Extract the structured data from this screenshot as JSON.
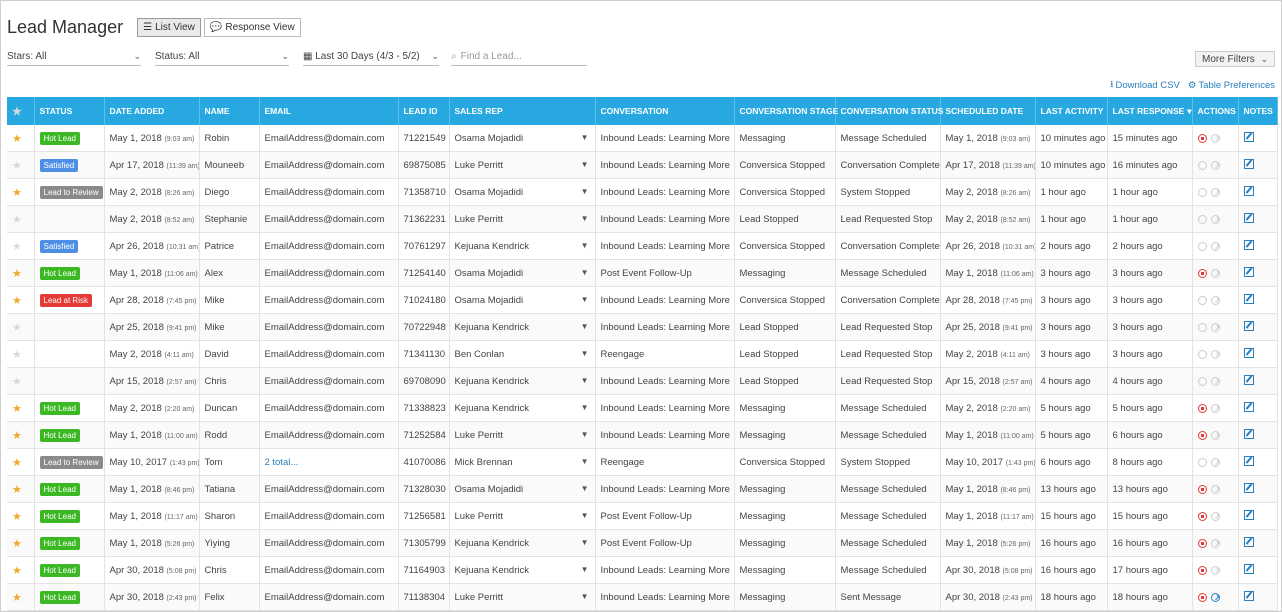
{
  "header": {
    "title": "Lead Manager",
    "list_view": "List View",
    "response_view": "Response View"
  },
  "filters": {
    "stars": "Stars: All",
    "status": "Status: All",
    "date_range": "Last 30 Days (4/3 - 5/2)",
    "search_placeholder": "Find a Lead...",
    "more_filters": "More Filters"
  },
  "links": {
    "download_csv": "Download CSV",
    "table_preferences": "Table Preferences"
  },
  "columns": [
    "STATUS",
    "DATE ADDED",
    "NAME",
    "EMAIL",
    "LEAD ID",
    "SALES REP",
    "CONVERSATION",
    "CONVERSATION STAGE",
    "CONVERSATION STATUS",
    "SCHEDULED DATE",
    "LAST ACTIVITY",
    "LAST RESPONSE",
    "ACTIONS",
    "NOTES"
  ],
  "sort_indicator": "▾",
  "colors": {
    "hot": "#3cb824",
    "satisfied": "#4e8fe6",
    "review": "#8a8a8a",
    "risk": "#e53935",
    "header": "#27a8e0"
  },
  "rows": [
    {
      "star": true,
      "status": "Hot Lead",
      "status_type": "hot",
      "date": "May 1, 2018",
      "date_time": "(9:03 am)",
      "name": "Robin",
      "email": "EmailAddress@domain.com",
      "lead_id": "71221549",
      "rep": "Osama Mojadidi",
      "conversation": "Inbound Leads: Learning More",
      "stage": "Messaging",
      "conv_status": "Message Scheduled",
      "sched": "May 1, 2018",
      "sched_time": "(9:03 am)",
      "last_activity": "10 minutes ago",
      "last_response": "15 minutes ago",
      "stop_active": true,
      "go_active": false
    },
    {
      "star": false,
      "status": "Satisfied",
      "status_type": "sat",
      "date": "Apr 17, 2018",
      "date_time": "(11:39 am)",
      "name": "Mouneeb",
      "email": "EmailAddress@domain.com",
      "lead_id": "69875085",
      "rep": "Luke Perritt",
      "conversation": "Inbound Leads: Learning More",
      "stage": "Conversica Stopped",
      "conv_status": "Conversation Complete",
      "sched": "Apr 17, 2018",
      "sched_time": "(11:39 am)",
      "last_activity": "10 minutes ago",
      "last_response": "16 minutes ago",
      "stop_active": false,
      "go_active": false
    },
    {
      "star": true,
      "status": "Lead to Review",
      "status_type": "rev",
      "date": "May 2, 2018",
      "date_time": "(8:26 am)",
      "name": "Diego",
      "email": "EmailAddress@domain.com",
      "lead_id": "71358710",
      "rep": "Osama Mojadidi",
      "conversation": "Inbound Leads: Learning More",
      "stage": "Conversica Stopped",
      "conv_status": "System Stopped",
      "sched": "May 2, 2018",
      "sched_time": "(8:26 am)",
      "last_activity": "1 hour ago",
      "last_response": "1 hour ago",
      "stop_active": false,
      "go_active": false
    },
    {
      "star": false,
      "status": "",
      "status_type": "",
      "date": "May 2, 2018",
      "date_time": "(8:52 am)",
      "name": "Stephanie",
      "email": "EmailAddress@domain.com",
      "lead_id": "71362231",
      "rep": "Luke Perritt",
      "conversation": "Inbound Leads: Learning More",
      "stage": "Lead Stopped",
      "conv_status": "Lead Requested Stop",
      "sched": "May 2, 2018",
      "sched_time": "(8:52 am)",
      "last_activity": "1 hour ago",
      "last_response": "1 hour ago",
      "stop_active": false,
      "go_active": false
    },
    {
      "star": false,
      "status": "Satisfied",
      "status_type": "sat",
      "date": "Apr 26, 2018",
      "date_time": "(10:31 am)",
      "name": "Patrice",
      "email": "EmailAddress@domain.com",
      "lead_id": "70761297",
      "rep": "Kejuana Kendrick",
      "conversation": "Inbound Leads: Learning More",
      "stage": "Conversica Stopped",
      "conv_status": "Conversation Complete",
      "sched": "Apr 26, 2018",
      "sched_time": "(10:31 am)",
      "last_activity": "2 hours ago",
      "last_response": "2 hours ago",
      "stop_active": false,
      "go_active": false
    },
    {
      "star": true,
      "status": "Hot Lead",
      "status_type": "hot",
      "date": "May 1, 2018",
      "date_time": "(11:06 am)",
      "name": "Alex",
      "email": "EmailAddress@domain.com",
      "lead_id": "71254140",
      "rep": "Osama Mojadidi",
      "conversation": "Post Event Follow-Up",
      "stage": "Messaging",
      "conv_status": "Message Scheduled",
      "sched": "May 1, 2018",
      "sched_time": "(11:06 am)",
      "last_activity": "3 hours ago",
      "last_response": "3 hours ago",
      "stop_active": true,
      "go_active": false
    },
    {
      "star": true,
      "status": "Lead at Risk",
      "status_type": "risk",
      "date": "Apr 28, 2018",
      "date_time": "(7:45 pm)",
      "name": "Mike",
      "email": "EmailAddress@domain.com",
      "lead_id": "71024180",
      "rep": "Osama Mojadidi",
      "conversation": "Inbound Leads: Learning More",
      "stage": "Conversica Stopped",
      "conv_status": "Conversation Complete",
      "sched": "Apr 28, 2018",
      "sched_time": "(7:45 pm)",
      "last_activity": "3 hours ago",
      "last_response": "3 hours ago",
      "stop_active": false,
      "go_active": false
    },
    {
      "star": false,
      "status": "",
      "status_type": "",
      "date": "Apr 25, 2018",
      "date_time": "(9:41 pm)",
      "name": "Mike",
      "email": "EmailAddress@domain.com",
      "lead_id": "70722948",
      "rep": "Kejuana Kendrick",
      "conversation": "Inbound Leads: Learning More",
      "stage": "Lead Stopped",
      "conv_status": "Lead Requested Stop",
      "sched": "Apr 25, 2018",
      "sched_time": "(9:41 pm)",
      "last_activity": "3 hours ago",
      "last_response": "3 hours ago",
      "stop_active": false,
      "go_active": false
    },
    {
      "star": false,
      "status": "",
      "status_type": "",
      "date": "May 2, 2018",
      "date_time": "(4:11 am)",
      "name": "David",
      "email": "EmailAddress@domain.com",
      "lead_id": "71341130",
      "rep": "Ben Conlan",
      "conversation": "Reengage",
      "stage": "Lead Stopped",
      "conv_status": "Lead Requested Stop",
      "sched": "May 2, 2018",
      "sched_time": "(4:11 am)",
      "last_activity": "3 hours ago",
      "last_response": "3 hours ago",
      "stop_active": false,
      "go_active": false
    },
    {
      "star": false,
      "status": "",
      "status_type": "",
      "date": "Apr 15, 2018",
      "date_time": "(2:57 am)",
      "name": "Chris",
      "email": "EmailAddress@domain.com",
      "lead_id": "69708090",
      "rep": "Kejuana Kendrick",
      "conversation": "Inbound Leads: Learning More",
      "stage": "Lead Stopped",
      "conv_status": "Lead Requested Stop",
      "sched": "Apr 15, 2018",
      "sched_time": "(2:57 am)",
      "last_activity": "4 hours ago",
      "last_response": "4 hours ago",
      "stop_active": false,
      "go_active": false
    },
    {
      "star": true,
      "status": "Hot Lead",
      "status_type": "hot",
      "date": "May 2, 2018",
      "date_time": "(2:20 am)",
      "name": "Duncan",
      "email": "EmailAddress@domain.com",
      "lead_id": "71338823",
      "rep": "Kejuana Kendrick",
      "conversation": "Inbound Leads: Learning More",
      "stage": "Messaging",
      "conv_status": "Message Scheduled",
      "sched": "May 2, 2018",
      "sched_time": "(2:20 am)",
      "last_activity": "5 hours ago",
      "last_response": "5 hours ago",
      "stop_active": true,
      "go_active": false
    },
    {
      "star": true,
      "status": "Hot Lead",
      "status_type": "hot",
      "date": "May 1, 2018",
      "date_time": "(11:00 am)",
      "name": "Rodd",
      "email": "EmailAddress@domain.com",
      "lead_id": "71252584",
      "rep": "Luke Perritt",
      "conversation": "Inbound Leads: Learning More",
      "stage": "Messaging",
      "conv_status": "Message Scheduled",
      "sched": "May 1, 2018",
      "sched_time": "(11:00 am)",
      "last_activity": "5 hours ago",
      "last_response": "6 hours ago",
      "stop_active": true,
      "go_active": false
    },
    {
      "star": true,
      "status": "Lead to Review",
      "status_type": "rev",
      "date": "May 10, 2017",
      "date_time": "(1:43 pm)",
      "name": "Tom",
      "email": "2 total...",
      "email_link": true,
      "lead_id": "41070086",
      "rep": "Mick Brennan",
      "conversation": "Reengage",
      "stage": "Conversica Stopped",
      "conv_status": "System Stopped",
      "sched": "May 10, 2017",
      "sched_time": "(1:43 pm)",
      "last_activity": "6 hours ago",
      "last_response": "8 hours ago",
      "stop_active": false,
      "go_active": false
    },
    {
      "star": true,
      "status": "Hot Lead",
      "status_type": "hot",
      "date": "May 1, 2018",
      "date_time": "(8:46 pm)",
      "name": "Tatiana",
      "email": "EmailAddress@domain.com",
      "lead_id": "71328030",
      "rep": "Osama Mojadidi",
      "conversation": "Inbound Leads: Learning More",
      "stage": "Messaging",
      "conv_status": "Message Scheduled",
      "sched": "May 1, 2018",
      "sched_time": "(8:46 pm)",
      "last_activity": "13 hours ago",
      "last_response": "13 hours ago",
      "stop_active": true,
      "go_active": false
    },
    {
      "star": true,
      "status": "Hot Lead",
      "status_type": "hot",
      "date": "May 1, 2018",
      "date_time": "(11:17 am)",
      "name": "Sharon",
      "email": "EmailAddress@domain.com",
      "lead_id": "71256581",
      "rep": "Luke Perritt",
      "conversation": "Post Event Follow-Up",
      "stage": "Messaging",
      "conv_status": "Message Scheduled",
      "sched": "May 1, 2018",
      "sched_time": "(11:17 am)",
      "last_activity": "15 hours ago",
      "last_response": "15 hours ago",
      "stop_active": true,
      "go_active": false
    },
    {
      "star": true,
      "status": "Hot Lead",
      "status_type": "hot",
      "date": "May 1, 2018",
      "date_time": "(5:26 pm)",
      "name": "Yiying",
      "email": "EmailAddress@domain.com",
      "lead_id": "71305799",
      "rep": "Kejuana Kendrick",
      "conversation": "Post Event Follow-Up",
      "stage": "Messaging",
      "conv_status": "Message Scheduled",
      "sched": "May 1, 2018",
      "sched_time": "(5:26 pm)",
      "last_activity": "16 hours ago",
      "last_response": "16 hours ago",
      "stop_active": true,
      "go_active": false
    },
    {
      "star": true,
      "status": "Hot Lead",
      "status_type": "hot",
      "date": "Apr 30, 2018",
      "date_time": "(5:08 pm)",
      "name": "Chris",
      "email": "EmailAddress@domain.com",
      "lead_id": "71164903",
      "rep": "Kejuana Kendrick",
      "conversation": "Inbound Leads: Learning More",
      "stage": "Messaging",
      "conv_status": "Message Scheduled",
      "sched": "Apr 30, 2018",
      "sched_time": "(5:08 pm)",
      "last_activity": "16 hours ago",
      "last_response": "17 hours ago",
      "stop_active": true,
      "go_active": false
    },
    {
      "star": true,
      "status": "Hot Lead",
      "status_type": "hot",
      "date": "Apr 30, 2018",
      "date_time": "(2:43 pm)",
      "name": "Felix",
      "email": "EmailAddress@domain.com",
      "lead_id": "71138304",
      "rep": "Luke Perritt",
      "conversation": "Inbound Leads: Learning More",
      "stage": "Messaging",
      "conv_status": "Sent Message",
      "sched": "Apr 30, 2018",
      "sched_time": "(2:43 pm)",
      "last_activity": "18 hours ago",
      "last_response": "18 hours ago",
      "stop_active": true,
      "go_active": true
    }
  ]
}
